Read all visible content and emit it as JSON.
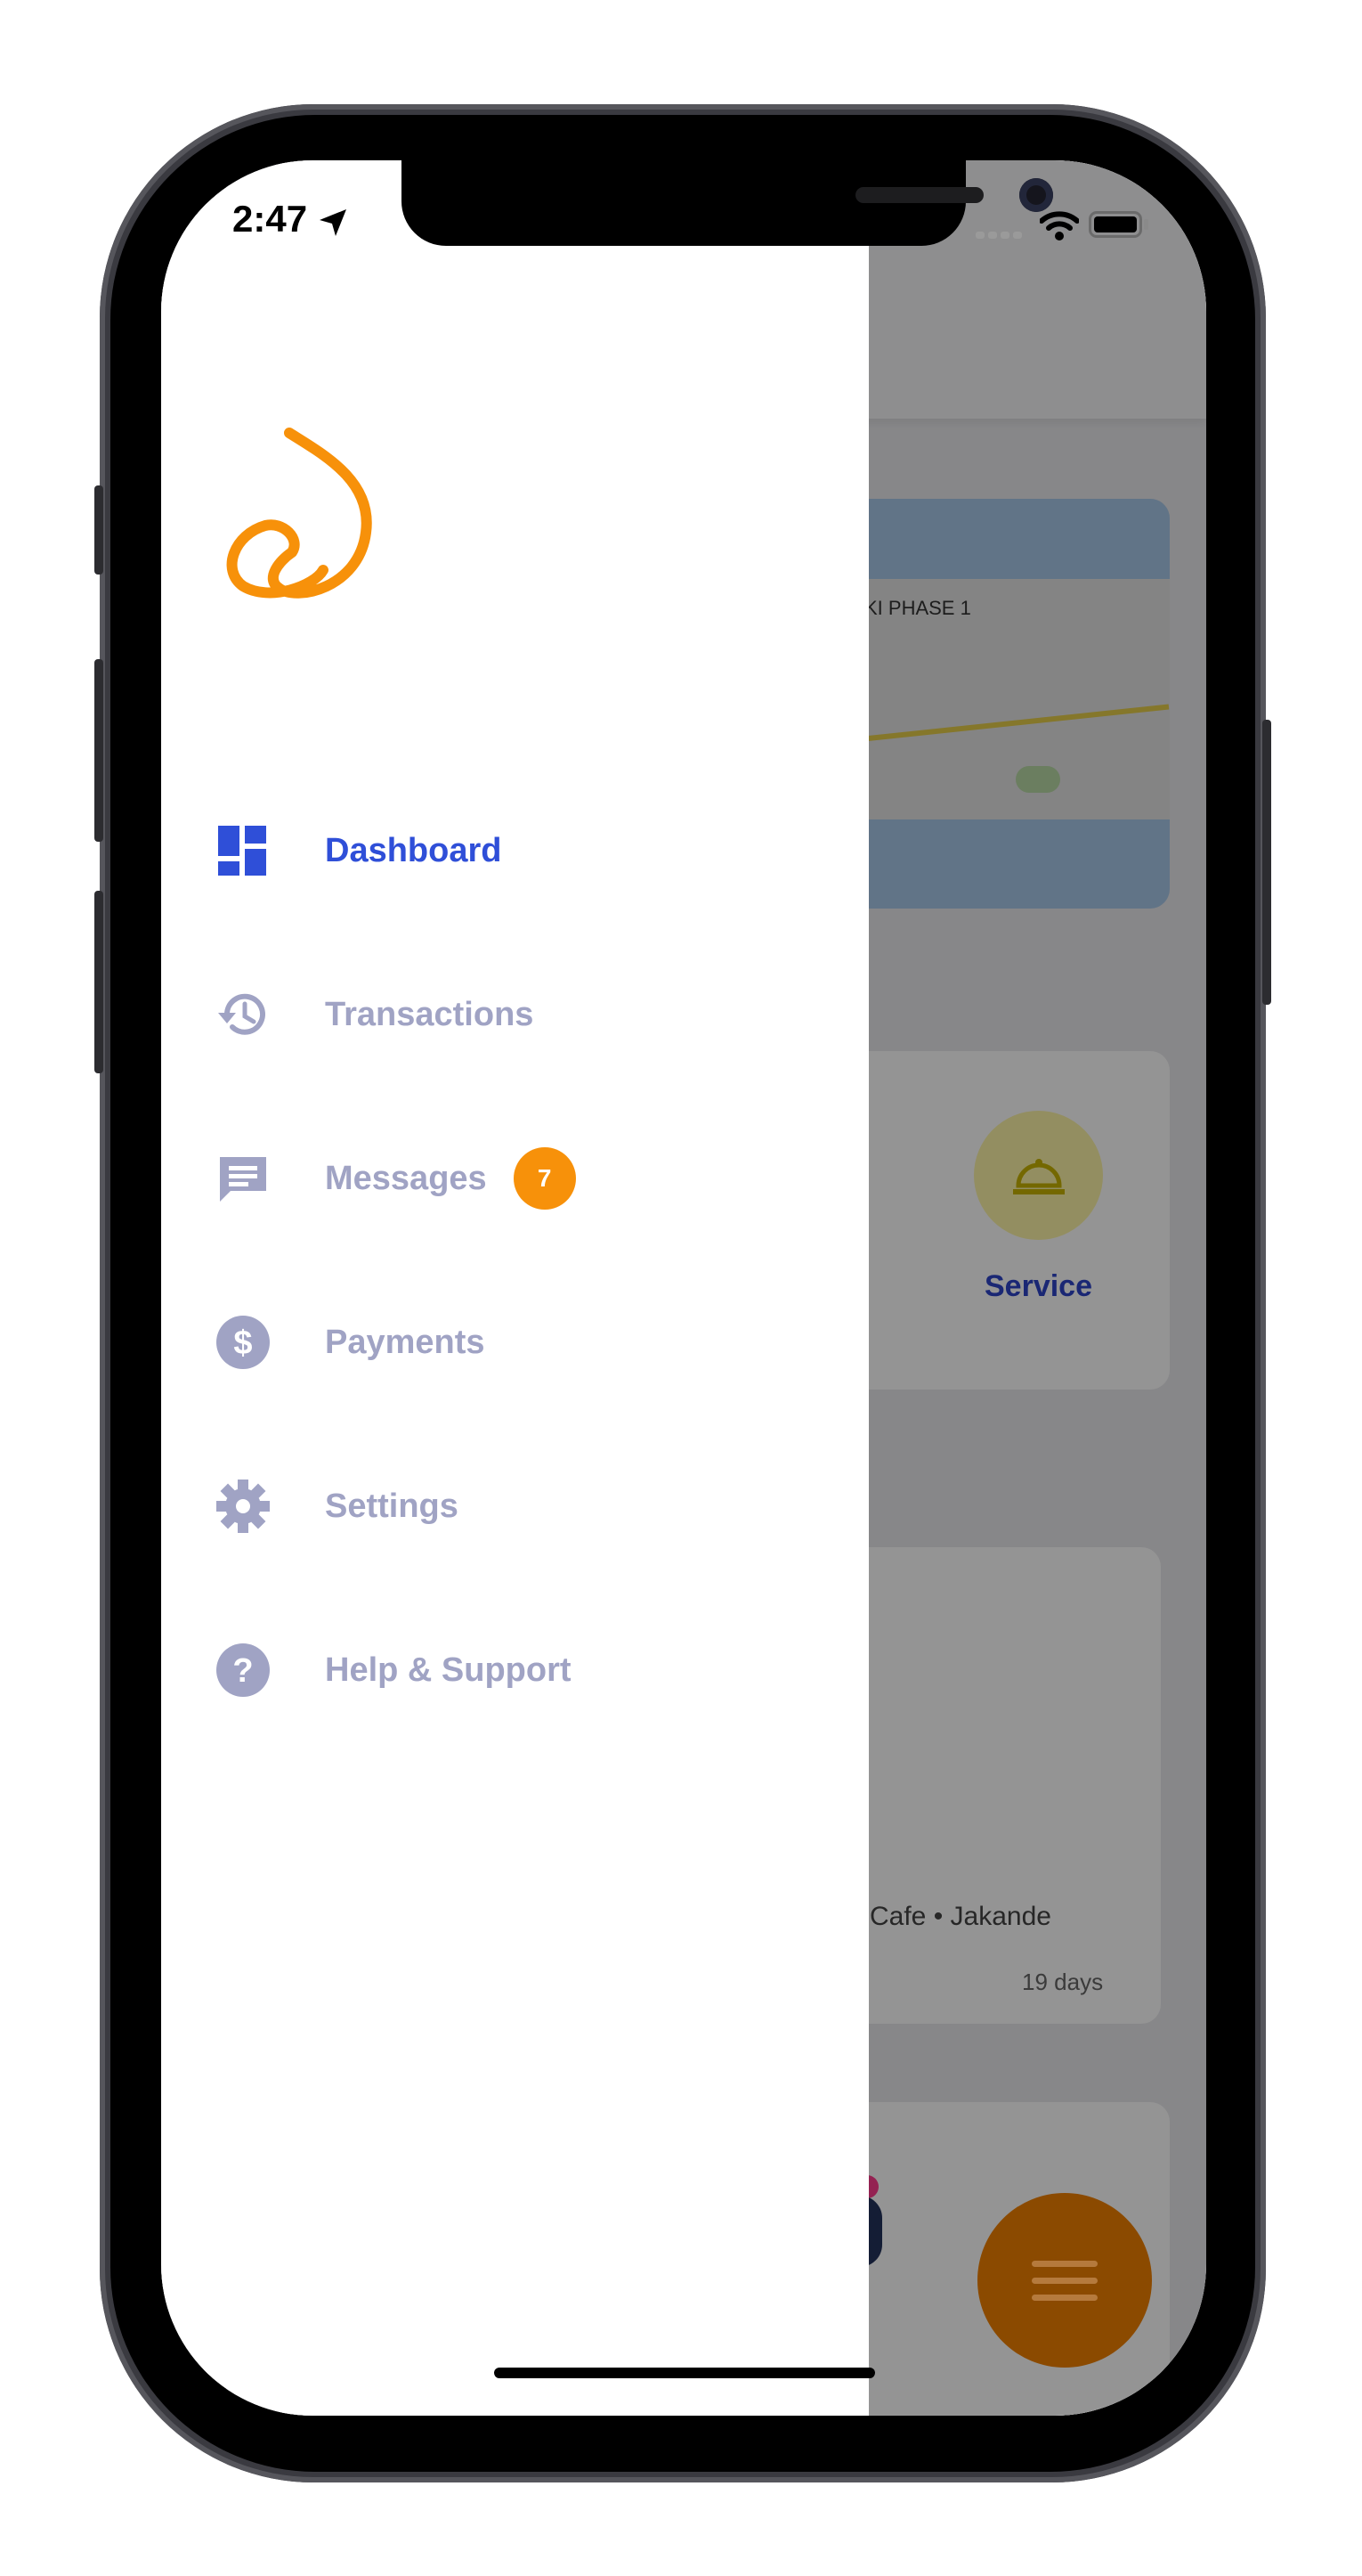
{
  "status_bar": {
    "time": "2:47"
  },
  "background_app": {
    "map_label": "KI PHASE 1",
    "service_label": "Service",
    "card_meta": "Cafe • Jakande",
    "card_age": "19 days"
  },
  "drawer": {
    "menu": [
      {
        "label": "Dashboard",
        "icon": "dashboard-icon",
        "active": true
      },
      {
        "label": "Transactions",
        "icon": "history-icon"
      },
      {
        "label": "Messages",
        "icon": "message-icon",
        "badge": "7"
      },
      {
        "label": "Payments",
        "icon": "dollar-icon"
      },
      {
        "label": "Settings",
        "icon": "gear-icon"
      },
      {
        "label": "Help & Support",
        "icon": "help-icon"
      }
    ]
  },
  "colors": {
    "accent": "#2f4fd8",
    "inactive": "#a0a3c4",
    "brand_orange": "#f7910a"
  }
}
